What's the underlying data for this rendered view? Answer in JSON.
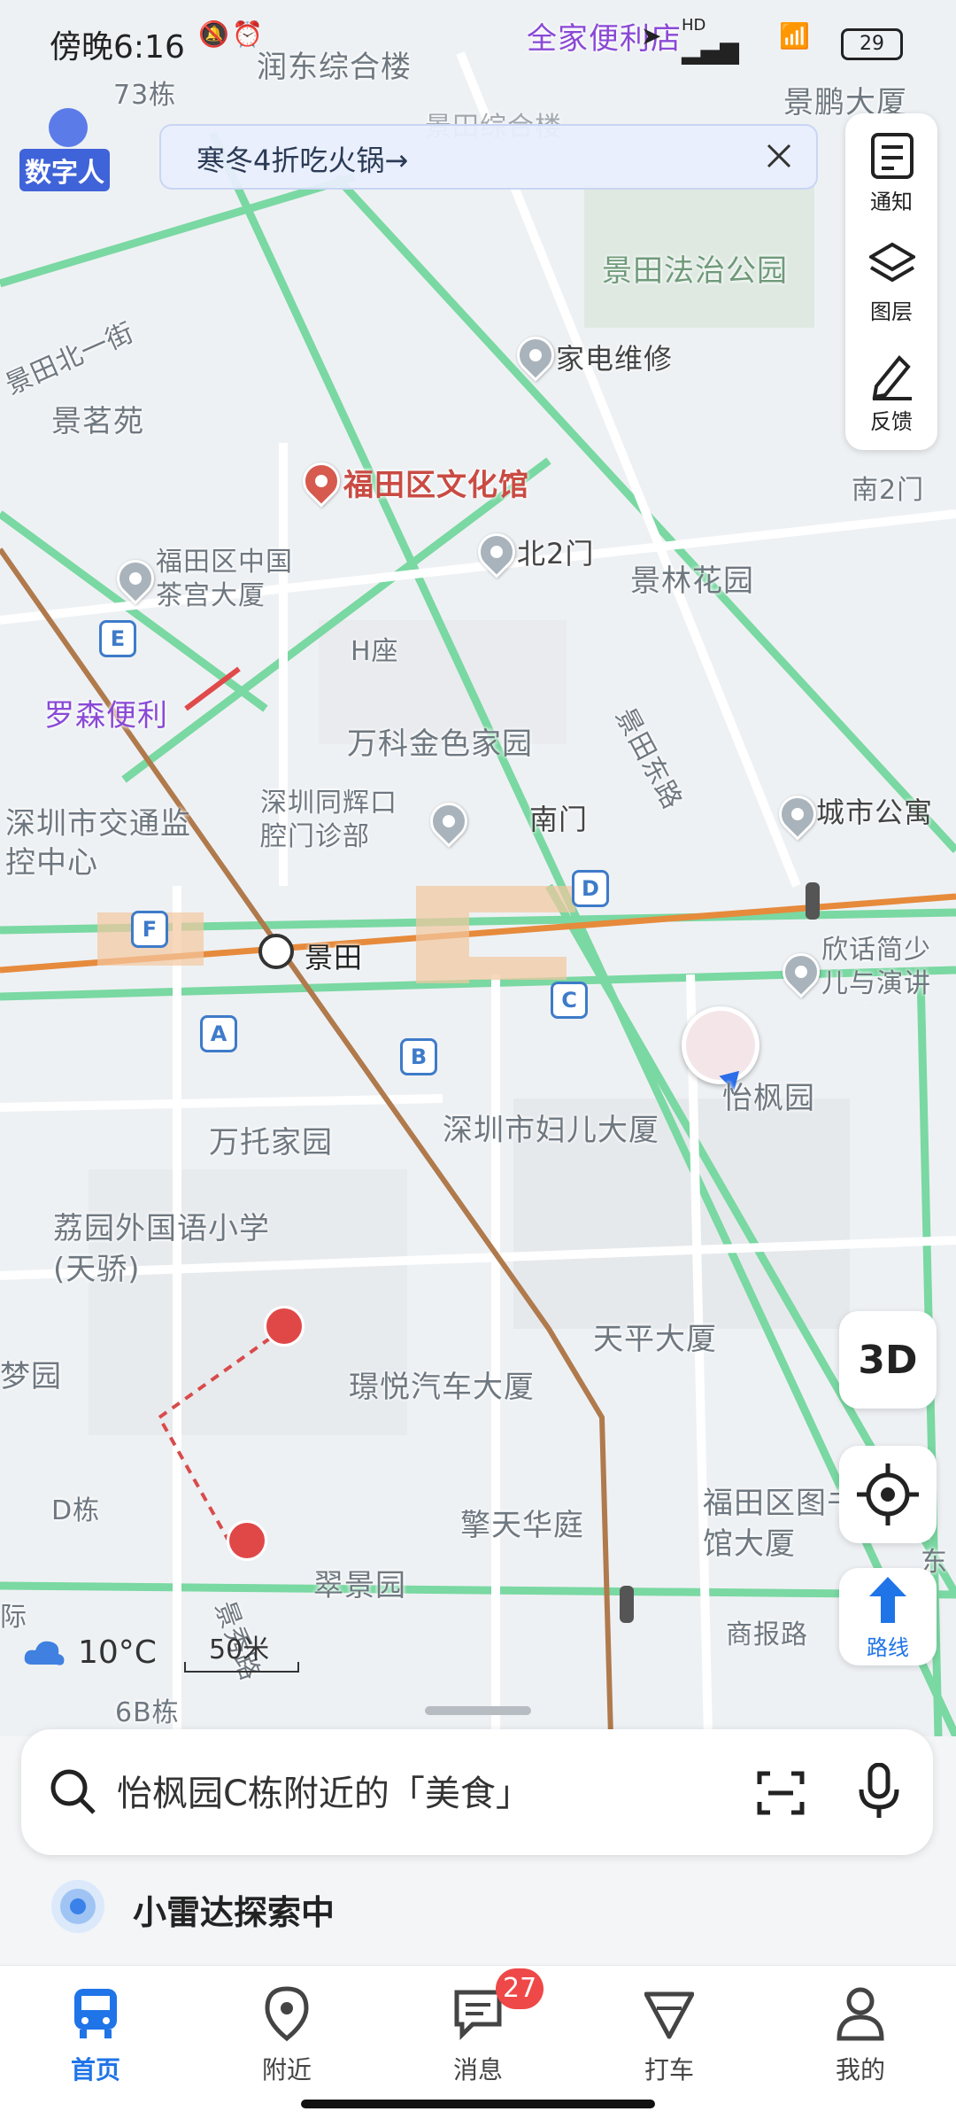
{
  "status_bar": {
    "time": "傍晚6:16",
    "battery": "29",
    "network": "HD"
  },
  "avatar": {
    "label": "数字人"
  },
  "promo": {
    "text": "寒冬4折吃火锅→"
  },
  "right_tools": [
    {
      "label": "通知",
      "icon": "notice-icon"
    },
    {
      "label": "图层",
      "icon": "layers-icon"
    },
    {
      "label": "反馈",
      "icon": "edit-icon"
    }
  ],
  "map": {
    "labels": {
      "top_store": "全家便利店",
      "building_73": "73栋",
      "runndong": "润东综合楼",
      "jingpeng": "景鹏大厦",
      "jingtian_zonghe": "景田综合楼",
      "fazhi_park": "景田法治公园",
      "jiadian": "家电维修",
      "jingtian_bei": "景田北一街",
      "jingmingyuan": "景茗苑",
      "wenhuaguan": "福田区文化馆",
      "nan2men_right": "南2门",
      "bei2men": "北2门",
      "jinglin": "景林花园",
      "chagong": "福田区中国茶宫大厦",
      "hzuo": "H座",
      "luosen": "罗森便利",
      "wanke": "万科金色家园",
      "jingtian_donglu": "景田东路",
      "jiaotong": "深圳市交通监控中心",
      "tonghui": "深圳同辉口腔门诊部",
      "nanmen": "南门",
      "chengshi": "城市公寓",
      "station": "景田",
      "xinhua": "欣话简少儿与演讲口才",
      "fuer": "深圳市妇儿大厦",
      "yifeng": "怡枫园",
      "wantuo": "万托家园",
      "liyuan": "荔园外国语小学(天骄)",
      "tianping": "天平大厦",
      "menyuan": "梦园",
      "jingyue": "璟悦汽车大厦",
      "dd": "D栋",
      "qingtian": "擎天华庭",
      "library": "福田区图书馆大厦",
      "dong": "东",
      "cuijing": "翠景园",
      "jingxiulu": "景秀路",
      "shangbao": "商报路",
      "b6": "6B栋",
      "xi": "际"
    },
    "exits": [
      "E",
      "F",
      "A",
      "B",
      "C",
      "D"
    ]
  },
  "weather": {
    "temp": "10°C",
    "icon": "cloud-icon"
  },
  "scale": {
    "label": "50米"
  },
  "floating": {
    "btn_3d": "3D",
    "route": "路线"
  },
  "search": {
    "text": "怡枫园C栋附近的「美食」"
  },
  "radar": {
    "text": "小雷达探索中"
  },
  "tabs": [
    {
      "label": "首页",
      "icon": "bus-icon",
      "active": true
    },
    {
      "label": "附近",
      "icon": "location-pin-icon",
      "active": false
    },
    {
      "label": "消息",
      "icon": "message-icon",
      "active": false
    },
    {
      "label": "打车",
      "icon": "taxi-icon",
      "active": false
    },
    {
      "label": "我的",
      "icon": "profile-icon",
      "active": false
    }
  ],
  "message_badge": "27",
  "colors": {
    "accent": "#1f74e8",
    "metro_line_orange": "#e68a3c",
    "metro_line_brown": "#b07a4c",
    "road_green": "#7ad8a2",
    "badge_red": "#ef4848"
  }
}
